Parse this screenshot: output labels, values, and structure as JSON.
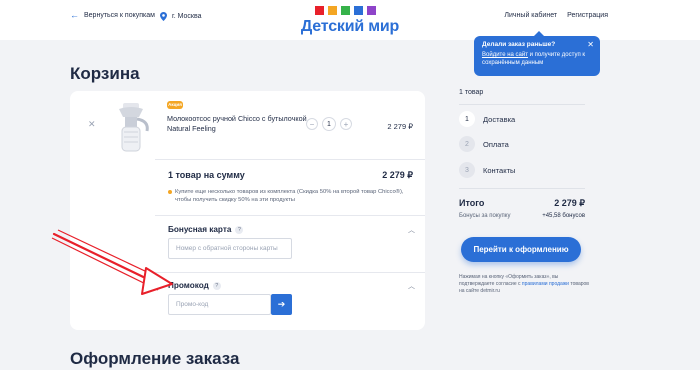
{
  "header": {
    "back_label": "Вернуться к покупкам",
    "city": "г. Москва",
    "logo_text": "Детский мир",
    "account_label": "Личный кабинет",
    "register_label": "Регистрация"
  },
  "tooltip": {
    "title": "Делали заказ раньше?",
    "link_text": "Войдите на сайт",
    "text": " и получите доступ к сохранённым данным"
  },
  "cart": {
    "title": "Корзина",
    "item": {
      "badge": "Акция",
      "name": "Молокоотсос ручной Chicco с бутылочкой Natural Feeling",
      "quantity": "1",
      "minus": "−",
      "plus": "+",
      "price": "2 279 ₽"
    },
    "summary_label": "1 товар на сумму",
    "summary_value": "2 279 ₽",
    "promo_note": "Купите еще несколько товаров из комплекта (Скидка 50% на второй товар Chicco®), чтобы получить скидку 50% на эти продукты",
    "bonus_card": {
      "label": "Бонусная карта",
      "help": "?",
      "placeholder": "Номер с обратной стороны карты"
    },
    "promo_code": {
      "label": "Промокод",
      "help": "?",
      "placeholder": "Промо-код"
    }
  },
  "checkout_title": "Оформление заказа",
  "sidebar": {
    "count": "1 товар",
    "steps": [
      {
        "num": "1",
        "label": "Доставка"
      },
      {
        "num": "2",
        "label": "Оплата"
      },
      {
        "num": "3",
        "label": "Контакты"
      }
    ],
    "total_label": "Итого",
    "total_value": "2 279 ₽",
    "bonus_label": "Бонусы за покупку",
    "bonus_value": "+45,58 бонусов",
    "cta": "Перейти к оформлению",
    "legal_pre": "Нажимая на кнопку «Оформить заказ», вы подтверждаете согласие с ",
    "legal_link": "правилами продажи",
    "legal_post": " товаров на сайте detmir.ru"
  },
  "colors": {
    "accent": "#2b6fd6",
    "badge": "#f4a623",
    "annotation_arrow": "#e8202a"
  }
}
